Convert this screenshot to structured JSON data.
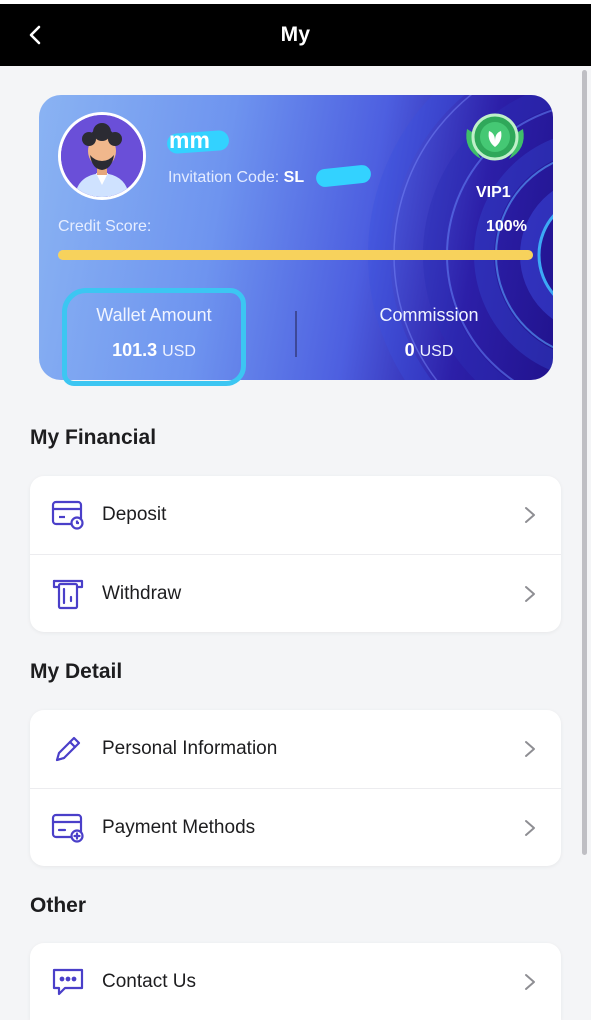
{
  "header": {
    "title": "My"
  },
  "profile": {
    "username": "mm",
    "invitation_label": "Invitation Code:",
    "invitation_code": "SL",
    "vip_level": "VIP1",
    "credit_label": "Credit Score:",
    "credit_value": "100%",
    "credit_fraction": 1.0,
    "wallet_label": "Wallet Amount",
    "wallet_amount": "101.3",
    "wallet_unit": "USD",
    "commission_label": "Commission",
    "commission_amount": "0",
    "commission_unit": "USD"
  },
  "sections": {
    "financial": {
      "title": "My Financial",
      "items": [
        {
          "label": "Deposit",
          "icon": "deposit-card-icon"
        },
        {
          "label": "Withdraw",
          "icon": "withdraw-icon"
        }
      ]
    },
    "detail": {
      "title": "My Detail",
      "items": [
        {
          "label": "Personal Information",
          "icon": "pencil-icon"
        },
        {
          "label": "Payment Methods",
          "icon": "payment-card-icon"
        }
      ]
    },
    "other": {
      "title": "Other",
      "items": [
        {
          "label": "Contact Us",
          "icon": "chat-bubble-icon"
        }
      ]
    }
  },
  "colors": {
    "accent_icon": "#4a3fc9",
    "progress": "#f7d25c",
    "highlight": "#3cc6f2"
  }
}
